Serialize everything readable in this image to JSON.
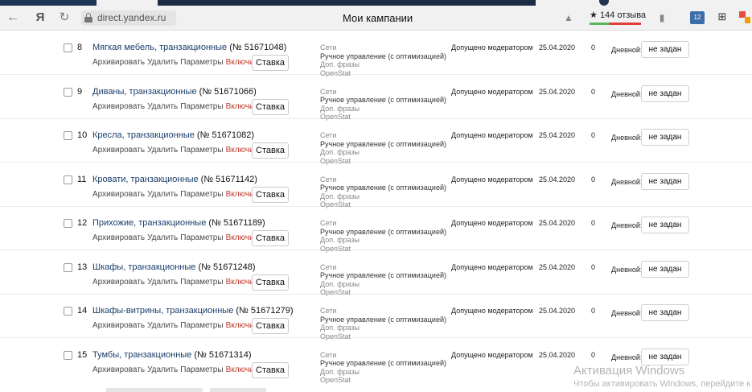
{
  "browser": {
    "address": "direct.yandex.ru",
    "title": "Мои кампании",
    "reviews": "144 отзыва",
    "ext_badge": "12",
    "yandex_button": "Я"
  },
  "row_labels": {
    "archive": "Архивировать",
    "delete": "Удалить",
    "params": "Параметры",
    "enable": "Включить",
    "bid": "Ставка",
    "networks": "Сети",
    "strategy": "Ручное управление (с оптимизацией)",
    "extra_phrases": "Доп. фразы",
    "openstat": "OpenStat",
    "daily": "Дневной:",
    "not_set": "не задан"
  },
  "campaigns": [
    {
      "num": "8",
      "name": "Мягкая мебель, транзакционные",
      "cid": "(№ 51671048)",
      "status": "Допущено модератором",
      "date": "25.04.2020",
      "value": "0"
    },
    {
      "num": "9",
      "name": "Диваны, транзакционные",
      "cid": "(№ 51671066)",
      "status": "Допущено модератором",
      "date": "25.04.2020",
      "value": "0"
    },
    {
      "num": "10",
      "name": "Кресла, транзакционные",
      "cid": "(№ 51671082)",
      "status": "Допущено модератором",
      "date": "25.04.2020",
      "value": "0"
    },
    {
      "num": "11",
      "name": "Кровати, транзакционные",
      "cid": "(№ 51671142)",
      "status": "Допущено модератором",
      "date": "25.04.2020",
      "value": "0"
    },
    {
      "num": "12",
      "name": "Прихожие, транзакционные",
      "cid": "(№ 51671189)",
      "status": "Допущено модератором",
      "date": "25.04.2020",
      "value": "0"
    },
    {
      "num": "13",
      "name": "Шкафы, транзакционные",
      "cid": "(№ 51671248)",
      "status": "Допущено модератором",
      "date": "25.04.2020",
      "value": "0"
    },
    {
      "num": "14",
      "name": "Шкафы-витрины, транзакционные",
      "cid": "(№ 51671279)",
      "status": "Допущено модератором",
      "date": "25.04.2020",
      "value": "0"
    },
    {
      "num": "15",
      "name": "Тумбы, транзакционные",
      "cid": "(№ 51671314)",
      "status": "Допущено модератором",
      "date": "25.04.2020",
      "value": "0"
    }
  ],
  "watermark": {
    "title": "Активация Windows",
    "subtitle": "Чтобы активировать Windows, перейдите к"
  }
}
